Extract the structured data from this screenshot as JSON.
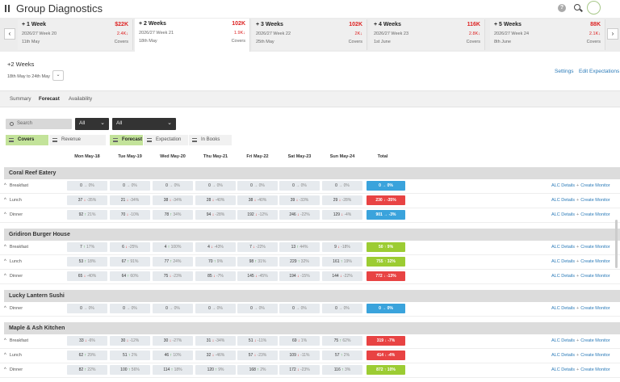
{
  "header": {
    "title": "Group Diagnostics",
    "help_icon": "?"
  },
  "weeks": [
    {
      "name": "+ 1 Week",
      "amount": "$22K",
      "sub": "2026/27 Week 20",
      "date": "11th May",
      "covers": "2.4K↓",
      "covers_label": "Covers"
    },
    {
      "name": "+ 2 Weeks",
      "amount": "102K",
      "sub": "2026/27 Week 21",
      "date": "18th May",
      "covers": "1.9K↓",
      "covers_label": "Covers"
    },
    {
      "name": "+ 3 Weeks",
      "amount": "102K",
      "sub": "2026/27 Week 22",
      "date": "25th May",
      "covers": "2K↓",
      "covers_label": "Covers"
    },
    {
      "name": "+ 4 Weeks",
      "amount": "116K",
      "sub": "2026/27 Week 23",
      "date": "1st June",
      "covers": "2.8K↓",
      "covers_label": "Covers"
    },
    {
      "name": "+ 5 Weeks",
      "amount": "88K",
      "sub": "2026/27 Week 24",
      "date": "8th June",
      "covers": "2.1K↓",
      "covers_label": "Covers"
    }
  ],
  "period": {
    "title": "+2 Weeks",
    "range": "18th May to 24th May"
  },
  "links": {
    "settings": "Settings",
    "edit": "Edit Expectations"
  },
  "tabs": [
    "Summary",
    "Forecast",
    "Availability"
  ],
  "filters": {
    "search_placeholder": "Search",
    "dd1": "All",
    "dd2": "All"
  },
  "toggles": [
    "Covers",
    "Revenue",
    "Forecast",
    "Expectation",
    "In Books"
  ],
  "columns": [
    "Mon May-18",
    "Tue May-19",
    "Wed May-20",
    "Thu May-21",
    "Fri May-22",
    "Sat May-23",
    "Sun May-24",
    "Total"
  ],
  "row_links": {
    "alc": "ALC Details",
    "sep": "+",
    "create": "Create Monitor"
  },
  "colors": {
    "total_blue": "#3aa3dc",
    "total_red": "#e84343",
    "total_green": "#9ccc33"
  },
  "restaurants": [
    {
      "name": "Coral Reef Eatery",
      "rows": [
        {
          "meal": "Breakfast",
          "cells": [
            [
              "0",
              "→",
              "0%",
              "fl"
            ],
            [
              "0",
              "→",
              "0%",
              "fl"
            ],
            [
              "0",
              "→",
              "0%",
              "fl"
            ],
            [
              "0",
              "→",
              "0%",
              "fl"
            ],
            [
              "0",
              "→",
              "0%",
              "fl"
            ],
            [
              "0",
              "→",
              "0%",
              "fl"
            ],
            [
              "0",
              "→",
              "0%",
              "fl"
            ]
          ],
          "total": "0 → 0%",
          "tcolor": "blue"
        },
        {
          "meal": "Lunch",
          "cells": [
            [
              "37",
              "↓",
              "-35%",
              "dn"
            ],
            [
              "21",
              "↓",
              "-34%",
              "dn"
            ],
            [
              "38",
              "↓",
              "-34%",
              "dn"
            ],
            [
              "28",
              "↓",
              "-40%",
              "dn"
            ],
            [
              "38",
              "↓",
              "-40%",
              "dn"
            ],
            [
              "39",
              "↓",
              "-33%",
              "dn"
            ],
            [
              "29",
              "↓",
              "-28%",
              "dn"
            ]
          ],
          "total": "230 ↓ -35%",
          "tcolor": "red"
        },
        {
          "meal": "Dinner",
          "cells": [
            [
              "92",
              "↑",
              "21%",
              "up"
            ],
            [
              "70",
              "↓",
              "-10%",
              "dn"
            ],
            [
              "78",
              "↑",
              "34%",
              "up"
            ],
            [
              "94",
              "↓",
              "-28%",
              "dn"
            ],
            [
              "192",
              "↓",
              "-12%",
              "dn"
            ],
            [
              "246",
              "↓",
              "-22%",
              "dn"
            ],
            [
              "129",
              "↓",
              "-4%",
              "dn"
            ]
          ],
          "total": "901 → -3%",
          "tcolor": "blue"
        }
      ]
    },
    {
      "name": "Gridiron Burger House",
      "rows": [
        {
          "meal": "Breakfast",
          "cells": [
            [
              "7",
              "↑",
              "17%",
              "up"
            ],
            [
              "6",
              "↓",
              "-25%",
              "dn"
            ],
            [
              "4",
              "↑",
              "100%",
              "up"
            ],
            [
              "4",
              "↓",
              "-43%",
              "dn"
            ],
            [
              "7",
              "↓",
              "-22%",
              "dn"
            ],
            [
              "13",
              "↑",
              "44%",
              "up"
            ],
            [
              "9",
              "↓",
              "-18%",
              "dn"
            ]
          ],
          "total": "50 ↑ 9%",
          "tcolor": "green"
        },
        {
          "meal": "Lunch",
          "cells": [
            [
              "53",
              "↑",
              "18%",
              "up"
            ],
            [
              "67",
              "↑",
              "91%",
              "up"
            ],
            [
              "77",
              "↑",
              "24%",
              "up"
            ],
            [
              "70",
              "↑",
              "9%",
              "up"
            ],
            [
              "98",
              "↑",
              "31%",
              "up"
            ],
            [
              "229",
              "↑",
              "32%",
              "up"
            ],
            [
              "161",
              "↑",
              "19%",
              "up"
            ]
          ],
          "total": "755 ↑ 32%",
          "tcolor": "green"
        },
        {
          "meal": "Dinner",
          "cells": [
            [
              "65",
              "↓",
              "-40%",
              "dn"
            ],
            [
              "64",
              "↑",
              "60%",
              "up"
            ],
            [
              "75",
              "↓",
              "-23%",
              "dn"
            ],
            [
              "85",
              "↓",
              "-7%",
              "dn"
            ],
            [
              "145",
              "↓",
              "-45%",
              "dn"
            ],
            [
              "194",
              "↓",
              "-15%",
              "dn"
            ],
            [
              "144",
              "↓",
              "-22%",
              "dn"
            ]
          ],
          "total": "772 ↓ -13%",
          "tcolor": "red"
        }
      ]
    },
    {
      "name": "Lucky Lantern Sushi",
      "rows": [
        {
          "meal": "Dinner",
          "cells": [
            [
              "0",
              "→",
              "0%",
              "fl"
            ],
            [
              "0",
              "→",
              "0%",
              "fl"
            ],
            [
              "0",
              "→",
              "0%",
              "fl"
            ],
            [
              "0",
              "→",
              "0%",
              "fl"
            ],
            [
              "0",
              "→",
              "0%",
              "fl"
            ],
            [
              "0",
              "→",
              "0%",
              "fl"
            ],
            [
              "0",
              "→",
              "0%",
              "fl"
            ]
          ],
          "total": "0 → 0%",
          "tcolor": "blue"
        }
      ]
    },
    {
      "name": "Maple & Ash Kitchen",
      "rows": [
        {
          "meal": "Breakfast",
          "cells": [
            [
              "33",
              "↓",
              "-6%",
              "dn"
            ],
            [
              "30",
              "↓",
              "-12%",
              "dn"
            ],
            [
              "30",
              "↓",
              "-27%",
              "dn"
            ],
            [
              "31",
              "↓",
              "-34%",
              "dn"
            ],
            [
              "51",
              "↓",
              "-11%",
              "dn"
            ],
            [
              "69",
              "↓",
              "1%",
              "dn"
            ],
            [
              "75",
              "↑",
              "62%",
              "up"
            ]
          ],
          "total": "319 ↓ -7%",
          "tcolor": "red"
        },
        {
          "meal": "Lunch",
          "cells": [
            [
              "62",
              "↑",
              "29%",
              "up"
            ],
            [
              "51",
              "↑",
              "2%",
              "up"
            ],
            [
              "46",
              "↑",
              "10%",
              "up"
            ],
            [
              "32",
              "↓",
              "-46%",
              "dn"
            ],
            [
              "57",
              "↓",
              "-23%",
              "dn"
            ],
            [
              "109",
              "↓",
              "-11%",
              "dn"
            ],
            [
              "57",
              "↑",
              "2%",
              "up"
            ]
          ],
          "total": "414 ↓ -4%",
          "tcolor": "red"
        },
        {
          "meal": "Dinner",
          "cells": [
            [
              "82",
              "↑",
              "22%",
              "up"
            ],
            [
              "100",
              "↑",
              "56%",
              "up"
            ],
            [
              "114",
              "↑",
              "18%",
              "up"
            ],
            [
              "120",
              "↑",
              "9%",
              "up"
            ],
            [
              "168",
              "↑",
              "2%",
              "up"
            ],
            [
              "172",
              "↓",
              "-23%",
              "dn"
            ],
            [
              "116",
              "↑",
              "3%",
              "up"
            ]
          ],
          "total": "872 ↑ 10%",
          "tcolor": "green"
        }
      ]
    }
  ]
}
